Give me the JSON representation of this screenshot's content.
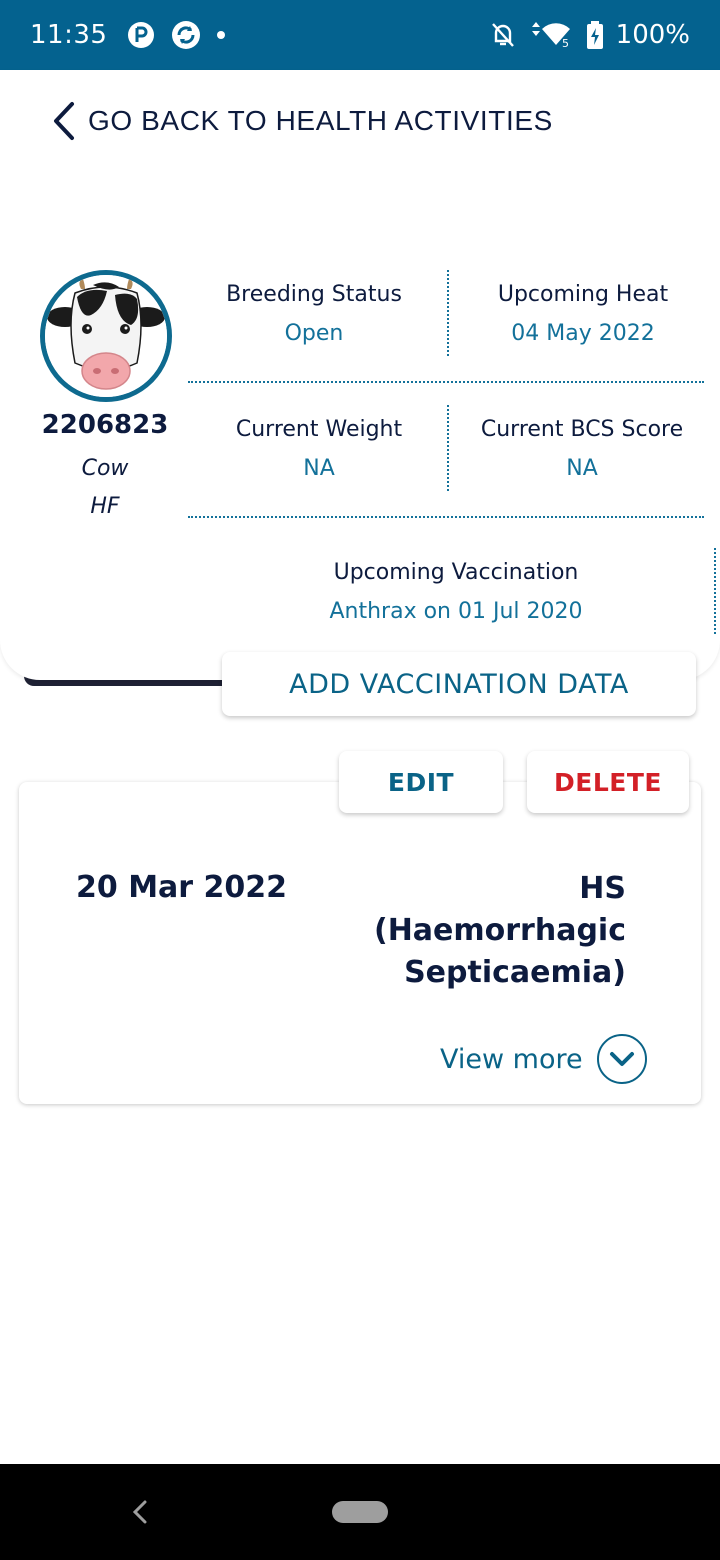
{
  "status_bar": {
    "time": "11:35",
    "battery": "100%"
  },
  "header": {
    "back_label": "GO BACK TO HEALTH ACTIVITIES"
  },
  "animal": {
    "id": "2206823",
    "type": "Cow",
    "breed": "HF"
  },
  "stats": {
    "breeding_status": {
      "label": "Breeding Status",
      "value": "Open"
    },
    "upcoming_heat": {
      "label": "Upcoming Heat",
      "value": "04 May 2022"
    },
    "current_weight": {
      "label": "Current Weight",
      "value": "NA"
    },
    "current_bcs": {
      "label": "Current BCS Score",
      "value": "NA"
    },
    "upcoming_vaccination": {
      "label": "Upcoming Vaccination",
      "value": "Anthrax on 01 Jul 2020"
    }
  },
  "actions": {
    "add_vaccination": "ADD VACCINATION DATA",
    "edit": "EDIT",
    "delete": "DELETE"
  },
  "record": {
    "date": "20 Mar 2022",
    "vaccine_line1": "HS",
    "vaccine_line2": "(Haemorrhagic",
    "vaccine_line3": "Septicaemia)",
    "view_more": "View more"
  },
  "colors": {
    "status_bar": "#04628f",
    "accent": "#0a6387",
    "danger": "#d32027",
    "text_dark": "#0d1b3e"
  }
}
